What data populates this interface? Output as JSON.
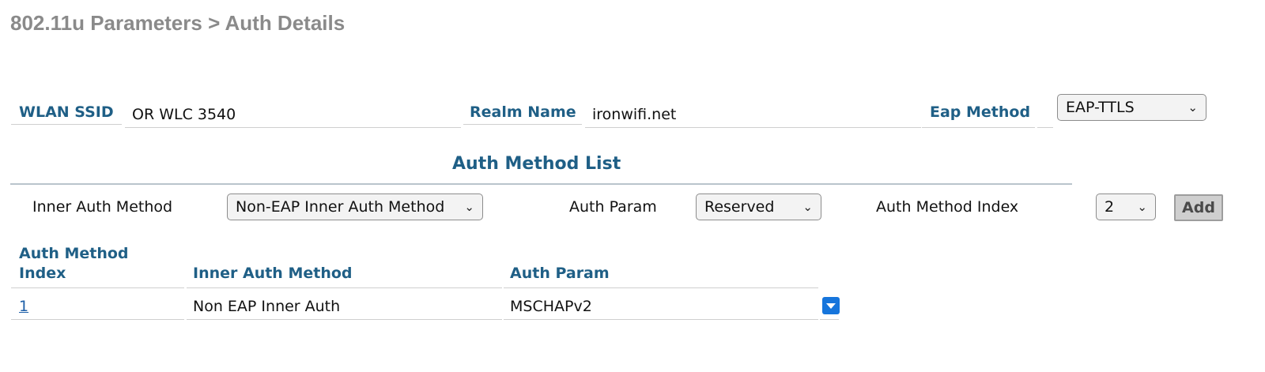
{
  "title": "802.11u Parameters > Auth Details",
  "fields": {
    "wlan_ssid": {
      "label": "WLAN SSID",
      "value": "OR WLC 3540"
    },
    "realm_name": {
      "label": "Realm Name",
      "value": "ironwifi.net"
    },
    "eap_method": {
      "label": "Eap Method",
      "selected": "EAP-TTLS"
    }
  },
  "section": {
    "title": "Auth Method List"
  },
  "add_row": {
    "inner_auth_label": "Inner Auth Method",
    "inner_auth_selected": "Non-EAP Inner Auth Method",
    "auth_param_label": "Auth Param",
    "auth_param_selected": "Reserved",
    "index_label": "Auth Method Index",
    "index_selected": "2",
    "add_label": "Add"
  },
  "table": {
    "headers": {
      "index": "Auth Method Index",
      "inner": "Inner Auth Method",
      "param": "Auth Param"
    },
    "rows": [
      {
        "index": "1",
        "inner": "Non EAP Inner Auth",
        "param": "MSCHAPv2"
      }
    ]
  },
  "icons": {
    "chevron": "chevron-down-icon",
    "row_menu": "dropdown-arrow-icon"
  },
  "colors": {
    "label": "#1f5f86",
    "title": "#8a8a8a",
    "link": "#1e5fa8",
    "row_menu": "#1675dc"
  }
}
